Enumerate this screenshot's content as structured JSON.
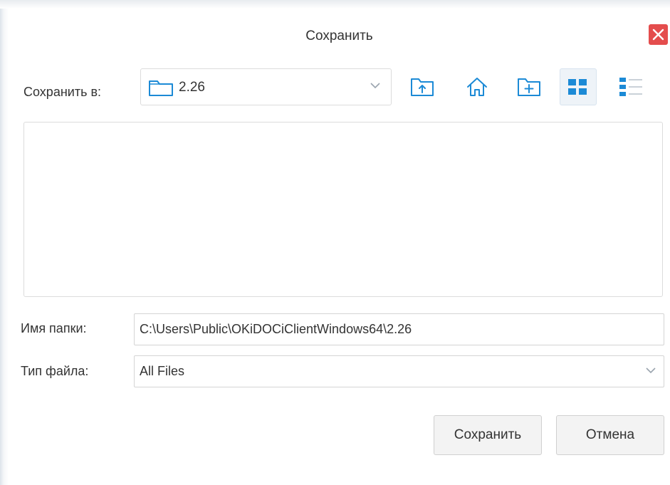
{
  "dialog": {
    "title": "Сохранить"
  },
  "look_in": {
    "label": "Сохранить в:",
    "current_folder": "2.26"
  },
  "toolbar": {
    "icons": [
      "folder-up-icon",
      "home-icon",
      "new-folder-icon",
      "list-view-icon",
      "details-view-icon"
    ],
    "active_view": "list-view"
  },
  "folder_name": {
    "label": "Имя папки:",
    "value": "C:\\Users\\Public\\OKiDOCiClientWindows64\\2.26"
  },
  "file_type": {
    "label": "Тип файла:",
    "selected": "All Files"
  },
  "buttons": {
    "save": "Сохранить",
    "cancel": "Отмена"
  },
  "colors": {
    "accent_icon": "#1c8ad6",
    "close_button": "#e44d4d"
  }
}
